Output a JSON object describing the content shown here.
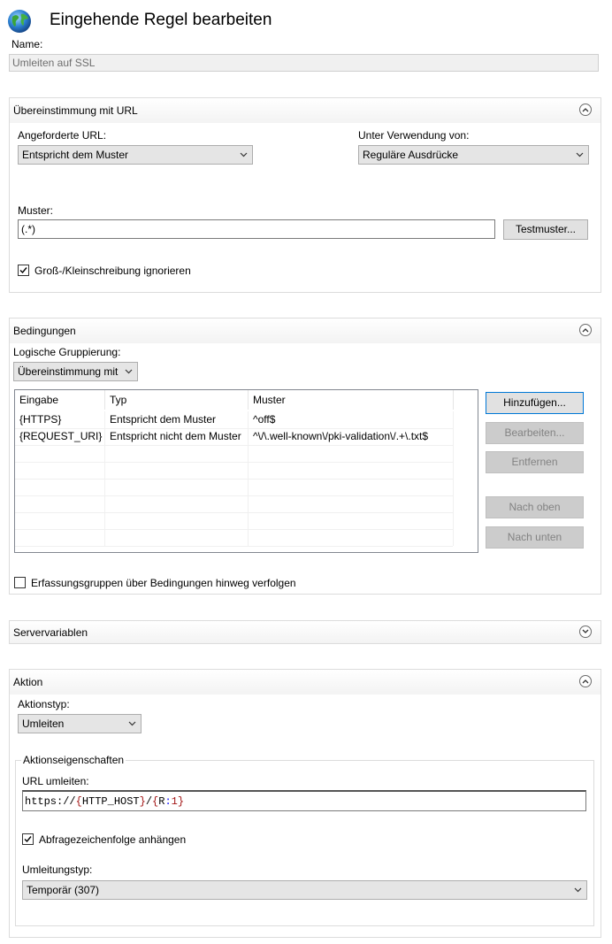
{
  "header": {
    "title": "Eingehende Regel bearbeiten",
    "icon": "globe-icon"
  },
  "name": {
    "label": "Name:",
    "value": "Umleiten auf SSL"
  },
  "match": {
    "title": "Übereinstimmung mit URL",
    "requested_url_label": "Angeforderte URL:",
    "requested_url_value": "Entspricht dem Muster",
    "using_label": "Unter Verwendung von:",
    "using_value": "Reguläre Ausdrücke",
    "pattern_label": "Muster:",
    "pattern_value": "(.*)",
    "test_button": "Testmuster...",
    "ignore_case_label": "Groß-/Kleinschreibung ignorieren",
    "ignore_case_checked": true
  },
  "conditions": {
    "title": "Bedingungen",
    "grouping_label": "Logische Gruppierung:",
    "grouping_value": "Übereinstimmung mit",
    "columns": [
      "Eingabe",
      "Typ",
      "Muster"
    ],
    "rows": [
      [
        "{HTTPS}",
        "Entspricht dem Muster",
        "^off$"
      ],
      [
        "{REQUEST_URI}",
        "Entspricht nicht dem Muster",
        "^\\/\\.well-known\\/pki-validation\\/.+\\.txt$"
      ]
    ],
    "buttons": {
      "add": "Hinzufügen...",
      "edit": "Bearbeiten...",
      "remove": "Entfernen",
      "up": "Nach oben",
      "down": "Nach unten"
    },
    "track_groups_label": "Erfassungsgruppen über Bedingungen hinweg verfolgen",
    "track_groups_checked": false
  },
  "server_vars": {
    "title": "Servervariablen"
  },
  "action": {
    "title": "Aktion",
    "type_label": "Aktionstyp:",
    "type_value": "Umleiten",
    "props_title": "Aktionseigenschaften",
    "redirect_url_label": "URL umleiten:",
    "redirect_url_parts": {
      "p1": "https://",
      "b1": "{",
      "v1": "HTTP_HOST",
      "b2": "}",
      "p2": "/",
      "b3": "{",
      "v2": "R",
      "p3": ":",
      "n1": "1",
      "b4": "}"
    },
    "append_query_label": "Abfragezeichenfolge anhängen",
    "append_query_checked": true,
    "redirect_type_label": "Umleitungstyp:",
    "redirect_type_value": "Temporär (307)"
  },
  "colors": {
    "accent": "#0078d7",
    "panel_border": "#dcdcdc",
    "button": "#e1e1e1"
  }
}
